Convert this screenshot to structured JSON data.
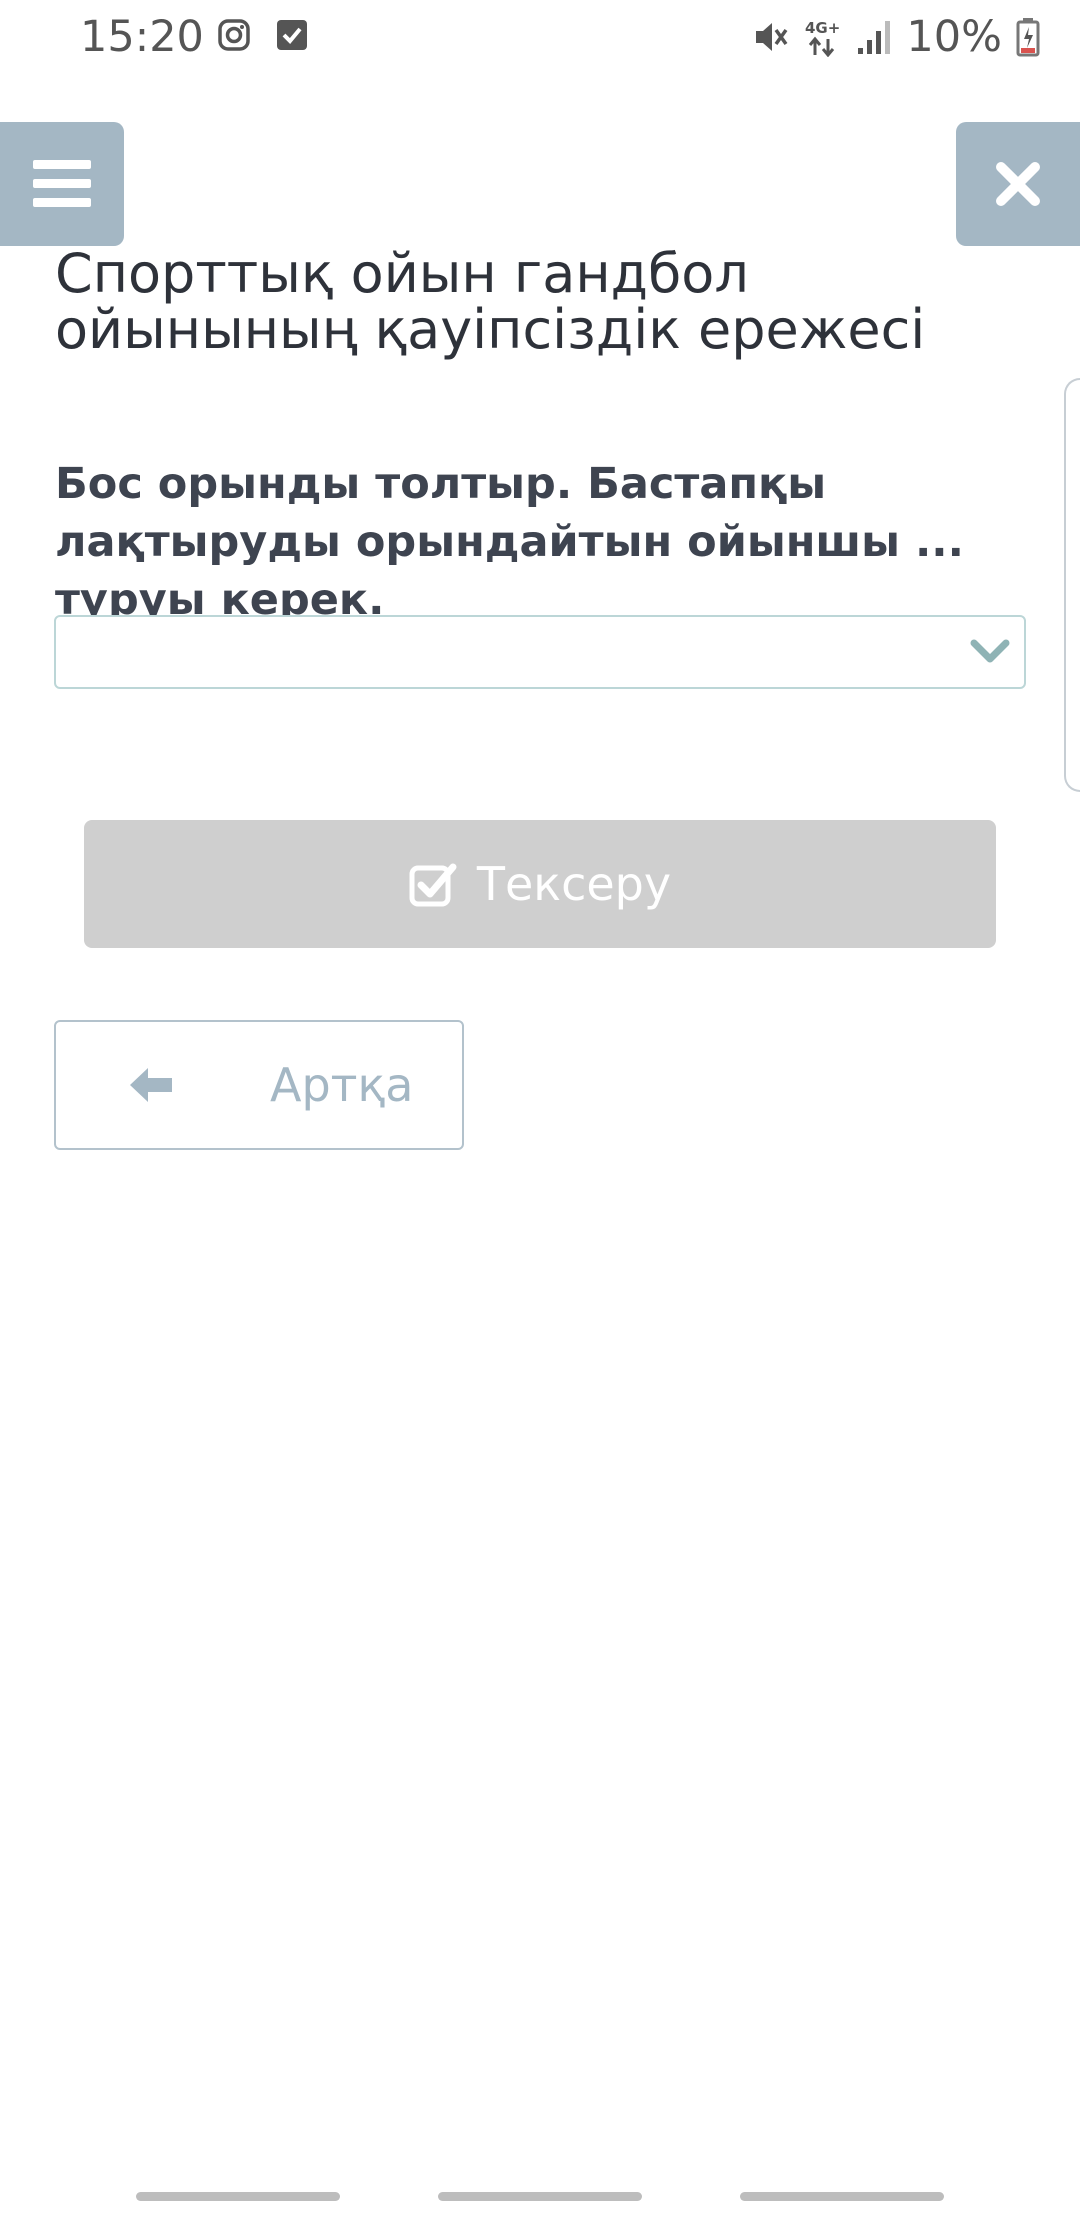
{
  "status_bar": {
    "time": "15:20",
    "network": "4G+",
    "battery": "10%"
  },
  "header": {
    "menu_icon": "hamburger-icon",
    "close_icon": "close-icon"
  },
  "page": {
    "title": "Спорттық ойын гандбол ойынының қауіпсіздік ережесі",
    "question": "Бос орынды толтыр. Бастапқы лақтыруды орындайтын ойыншы ... тұруы керек."
  },
  "answer_select": {
    "selected_value": "",
    "icon": "chevron-down-icon",
    "border_color": "#bcd6d7"
  },
  "check_button": {
    "label": "Тексеру",
    "icon": "check-square-icon",
    "background": "#cfcfcf"
  },
  "back_button": {
    "label": "Артқа",
    "icon": "arrow-left-icon"
  },
  "colors": {
    "header_button": "#a4b7c4",
    "title_text": "#2e323a",
    "question_text": "#3e4450"
  }
}
